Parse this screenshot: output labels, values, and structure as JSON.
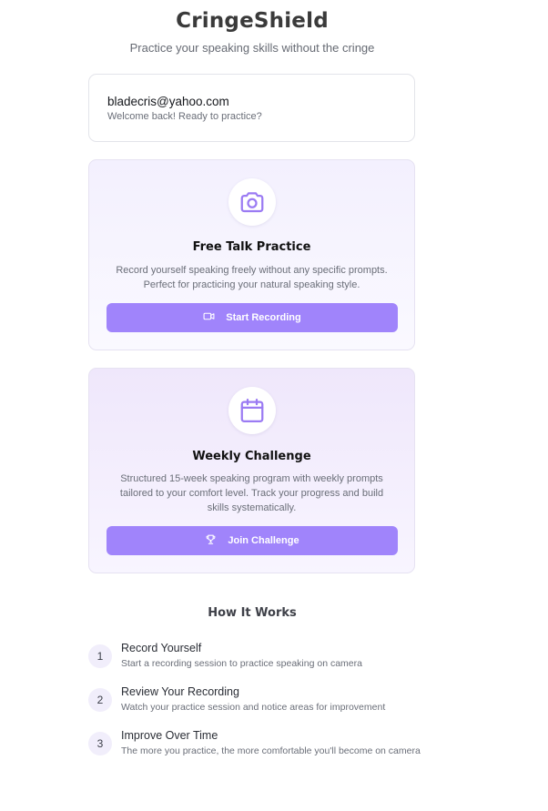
{
  "header": {
    "title": "CringeShield",
    "subtitle": "Practice your speaking skills without the cringe"
  },
  "user": {
    "email": "bladecris@yahoo.com",
    "welcome": "Welcome back! Ready to practice?"
  },
  "cards": {
    "free_talk": {
      "icon": "camera-icon",
      "title": "Free Talk Practice",
      "description": "Record yourself speaking freely without any specific prompts. Perfect for practicing your natural speaking style.",
      "button_icon": "video-icon",
      "button_label": "Start Recording"
    },
    "weekly": {
      "icon": "calendar-icon",
      "title": "Weekly Challenge",
      "description": "Structured 15-week speaking program with weekly prompts tailored to your comfort level. Track your progress and build skills systematically.",
      "button_icon": "trophy-icon",
      "button_label": "Join Challenge"
    }
  },
  "how_it_works": {
    "title": "How It Works",
    "steps": [
      {
        "number": "1",
        "title": "Record Yourself",
        "description": "Start a recording session to practice speaking on camera"
      },
      {
        "number": "2",
        "title": "Review Your Recording",
        "description": "Watch your practice session and notice areas for improvement"
      },
      {
        "number": "3",
        "title": "Improve Over Time",
        "description": "The more you practice, the more comfortable you'll become on camera"
      }
    ]
  },
  "colors": {
    "accent": "#a084fb",
    "icon": "#9b7bf3"
  }
}
